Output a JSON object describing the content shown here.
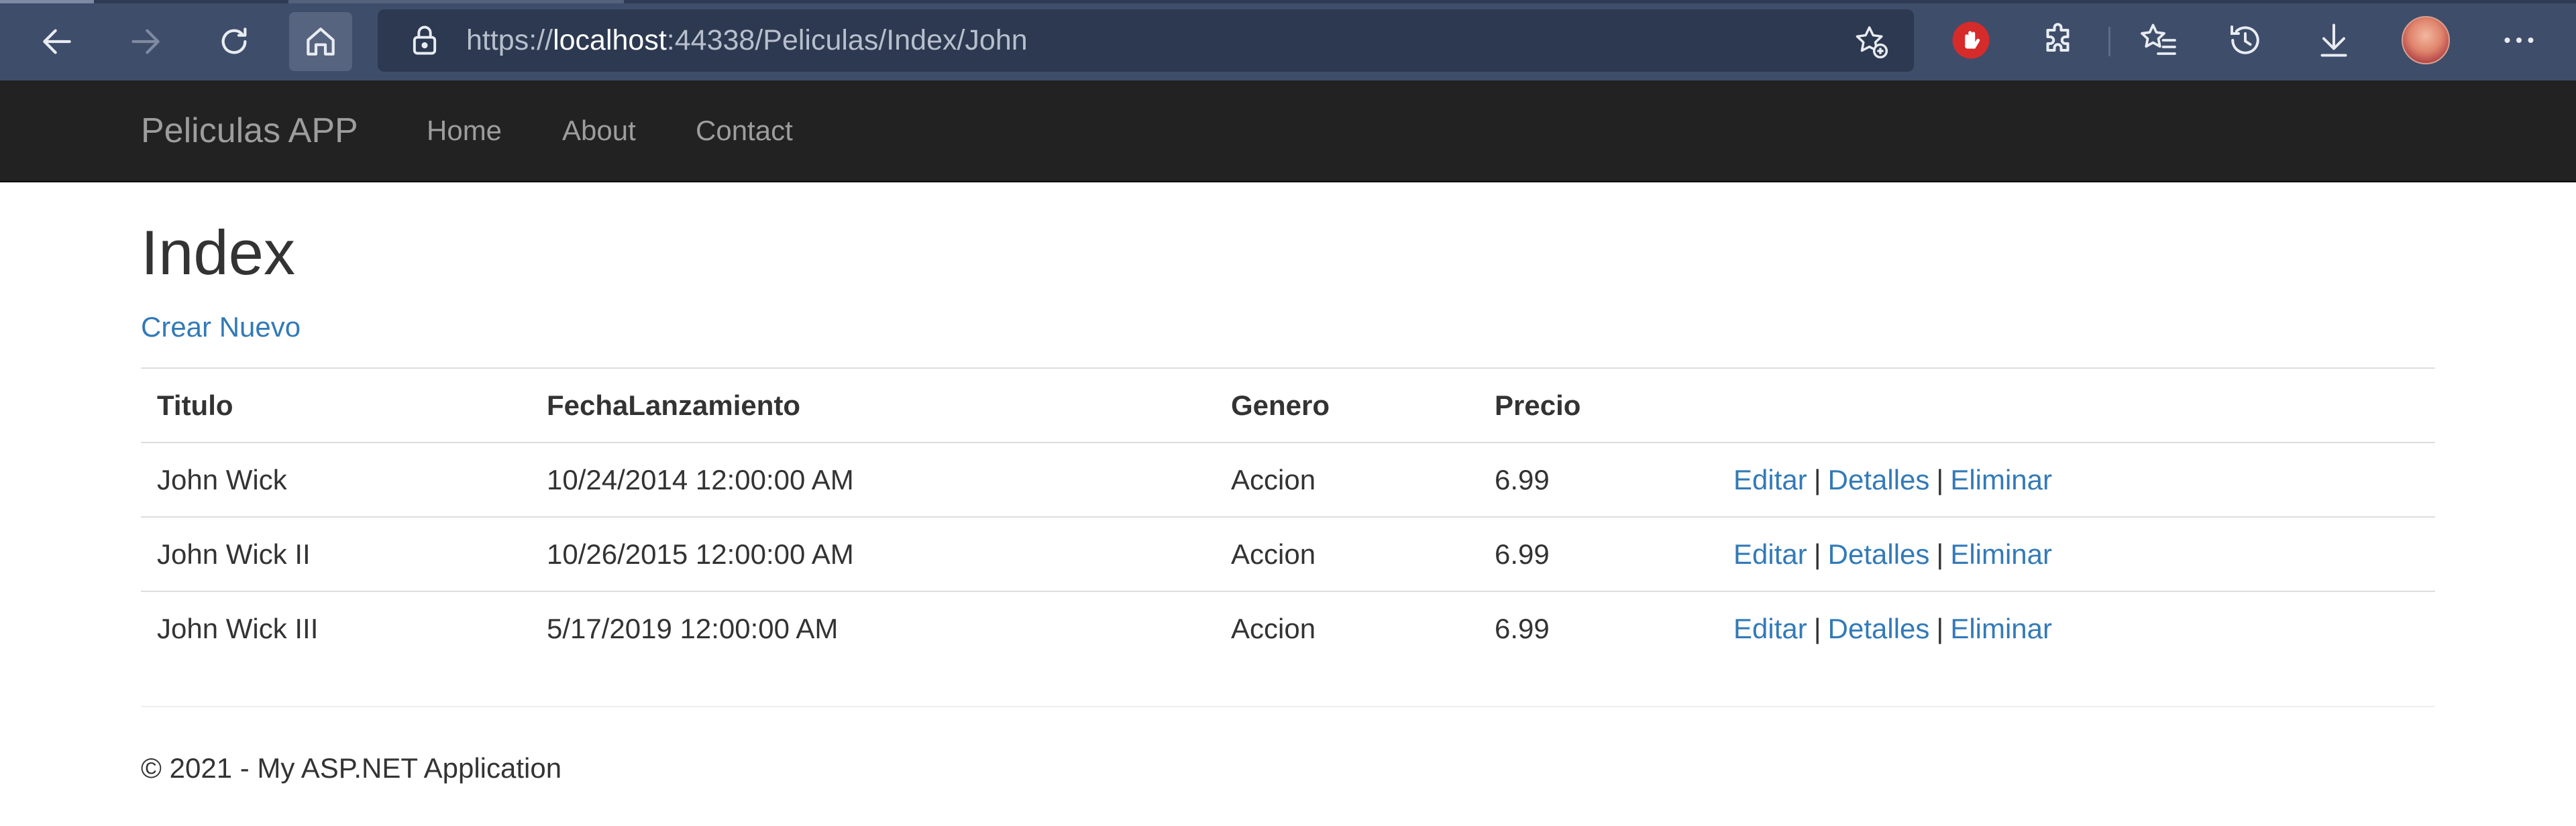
{
  "browser": {
    "url_prefix": "https://",
    "url_host": "localhost",
    "url_rest": ":44338/Peliculas/Index/John",
    "icons": {
      "back": "arrow-left-icon",
      "forward": "arrow-right-icon",
      "refresh": "refresh-icon",
      "home": "home-icon",
      "lock": "lock-icon",
      "favorite": "star-add-icon",
      "extension_block": "stop-hand-icon",
      "extensions": "puzzle-icon",
      "favorites": "favorites-list-icon",
      "history": "history-icon",
      "downloads": "download-icon",
      "more": "more-dots-icon"
    },
    "colors": {
      "chrome": "#3e4d6a",
      "address": "#2c3950",
      "block_red": "#d62b2b"
    }
  },
  "navbar": {
    "brand": "Peliculas APP",
    "links": [
      "Home",
      "About",
      "Contact"
    ]
  },
  "main": {
    "title": "Index",
    "create_link": "Crear Nuevo",
    "table": {
      "headers": [
        "Titulo",
        "FechaLanzamiento",
        "Genero",
        "Precio"
      ],
      "rows": [
        {
          "titulo": "John Wick",
          "fecha": "10/24/2014 12:00:00 AM",
          "genero": "Accion",
          "precio": "6.99"
        },
        {
          "titulo": "John Wick II",
          "fecha": "10/26/2015 12:00:00 AM",
          "genero": "Accion",
          "precio": "6.99"
        },
        {
          "titulo": "John Wick III",
          "fecha": "5/17/2019 12:00:00 AM",
          "genero": "Accion",
          "precio": "6.99"
        }
      ],
      "actions": {
        "edit": "Editar",
        "details": "Detalles",
        "delete": "Eliminar",
        "separator": "|"
      }
    }
  },
  "footer": {
    "text": "© 2021 - My ASP.NET Application"
  },
  "colors": {
    "link": "#337ab7",
    "navbar": "#222222",
    "navtext": "#9d9d9d"
  }
}
